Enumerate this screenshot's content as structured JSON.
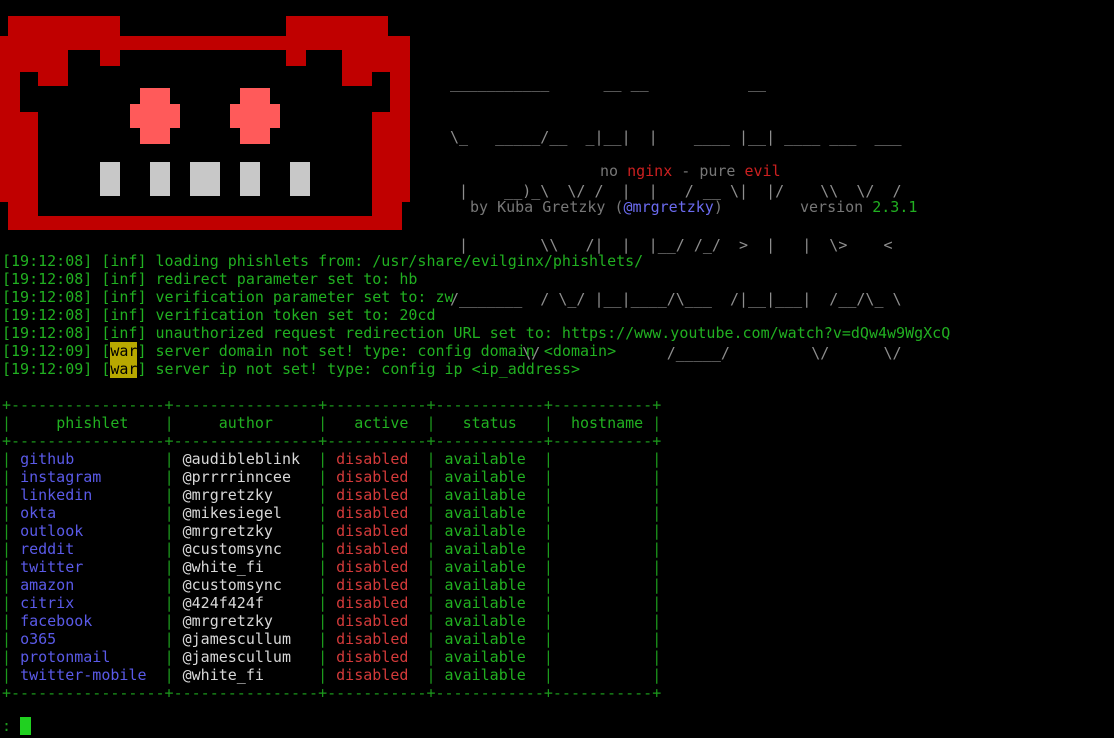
{
  "banner": {
    "logo_text_lines": [
      "___________      __ __           __               ",
      "\\_   _____/__  _|__|  |    ____ |__| ____ ___  ___",
      " |    __)_\\  \\/ /  |  |   / __ \\|  |/    \\\\  \\/  /",
      " |        \\\\   /|  |  |__/ /_/  >  |   |  \\>    < ",
      "/_______  / \\_/ |__|____/\\___  /|__|___|  /__/\\_ \\",
      "        \\/              /_____/         \\/      \\/"
    ],
    "tagline_parts": [
      "no ",
      "nginx",
      " - pure ",
      "evil"
    ],
    "byline_prefix": "by Kuba Gretzky (",
    "byline_handle": "@mrgretzky",
    "byline_suffix": ")",
    "version_label": "version ",
    "version_number": "2.3.1"
  },
  "log": [
    {
      "time": "[19:12:08]",
      "level": "inf",
      "msg": "loading phishlets from: /usr/share/evilginx/phishlets/"
    },
    {
      "time": "[19:12:08]",
      "level": "inf",
      "msg": "redirect parameter set to: hb"
    },
    {
      "time": "[19:12:08]",
      "level": "inf",
      "msg": "verification parameter set to: zw"
    },
    {
      "time": "[19:12:08]",
      "level": "inf",
      "msg": "verification token set to: 20cd"
    },
    {
      "time": "[19:12:08]",
      "level": "inf",
      "msg": "unauthorized request redirection URL set to: https://www.youtube.com/watch?v=dQw4w9WgXcQ"
    },
    {
      "time": "[19:12:09]",
      "level": "war",
      "msg": "server domain not set! type: config domain <domain>"
    },
    {
      "time": "[19:12:09]",
      "level": "war",
      "msg": "server ip not set! type: config ip <ip_address>"
    }
  ],
  "table": {
    "border_line": "+-----------------+----------------+-----------+------------+-----------+",
    "headers": [
      "phishlet",
      "author",
      "active",
      "status",
      "hostname"
    ],
    "rows": [
      {
        "phishlet": "github",
        "author": "@audibleblink",
        "active": "disabled",
        "status": "available",
        "hostname": ""
      },
      {
        "phishlet": "instagram",
        "author": "@prrrrinncee",
        "active": "disabled",
        "status": "available",
        "hostname": ""
      },
      {
        "phishlet": "linkedin",
        "author": "@mrgretzky",
        "active": "disabled",
        "status": "available",
        "hostname": ""
      },
      {
        "phishlet": "okta",
        "author": "@mikesiegel",
        "active": "disabled",
        "status": "available",
        "hostname": ""
      },
      {
        "phishlet": "outlook",
        "author": "@mrgretzky",
        "active": "disabled",
        "status": "available",
        "hostname": ""
      },
      {
        "phishlet": "reddit",
        "author": "@customsync",
        "active": "disabled",
        "status": "available",
        "hostname": ""
      },
      {
        "phishlet": "twitter",
        "author": "@white_fi",
        "active": "disabled",
        "status": "available",
        "hostname": ""
      },
      {
        "phishlet": "amazon",
        "author": "@customsync",
        "active": "disabled",
        "status": "available",
        "hostname": ""
      },
      {
        "phishlet": "citrix",
        "author": "@424f424f",
        "active": "disabled",
        "status": "available",
        "hostname": ""
      },
      {
        "phishlet": "facebook",
        "author": "@mrgretzky",
        "active": "disabled",
        "status": "available",
        "hostname": ""
      },
      {
        "phishlet": "o365",
        "author": "@jamescullum",
        "active": "disabled",
        "status": "available",
        "hostname": ""
      },
      {
        "phishlet": "protonmail",
        "author": "@jamescullum",
        "active": "disabled",
        "status": "available",
        "hostname": ""
      },
      {
        "phishlet": "twitter-mobile",
        "author": "@white_fi",
        "active": "disabled",
        "status": "available",
        "hostname": ""
      }
    ]
  },
  "prompt": {
    "symbol": ":",
    "input": ""
  },
  "colors": {
    "logo_red": "#c00000",
    "eyes": "#ff5a5a",
    "teeth": "#c8c8c8",
    "green": "#21b021",
    "blue": "#5a5ae8",
    "red": "#d33a3a",
    "warn_bg": "#b8a800"
  }
}
